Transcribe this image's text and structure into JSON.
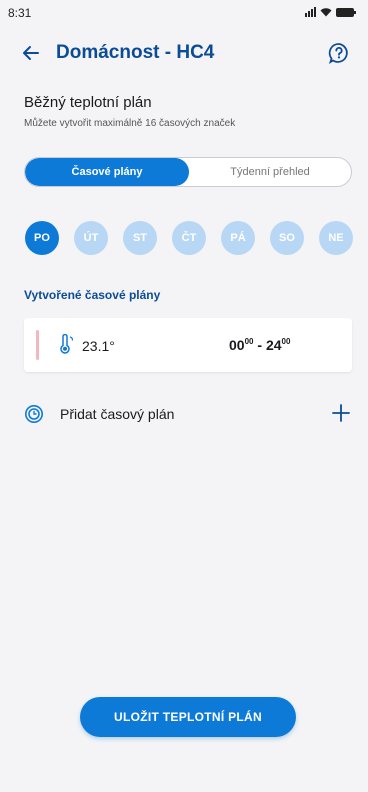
{
  "status_bar": {
    "time": "8:31"
  },
  "app_bar": {
    "title": "Domácnost - HC4"
  },
  "plan": {
    "title": "Běžný teplotní plán",
    "subtitle": "Můžete vytvořit maximálně 16 časových značek"
  },
  "tabs": [
    {
      "label": "Časové plány",
      "active": true
    },
    {
      "label": "Týdenní přehled",
      "active": false
    }
  ],
  "days": [
    {
      "label": "PO",
      "active": true
    },
    {
      "label": "ÚT",
      "active": false
    },
    {
      "label": "ST",
      "active": false
    },
    {
      "label": "ČT",
      "active": false
    },
    {
      "label": "PÁ",
      "active": false
    },
    {
      "label": "SO",
      "active": false
    },
    {
      "label": "NE",
      "active": false
    }
  ],
  "section_title": "Vytvořené časové plány",
  "schedules": [
    {
      "temperature": "23.1°",
      "start_h": "00",
      "start_m": "00",
      "separator": " - ",
      "end_h": "24",
      "end_m": "00"
    }
  ],
  "add_plan_label": "Přidat časový plán",
  "save_button": "ULOŽIT TEPLOTNÍ PLÁN",
  "colors": {
    "primary": "#0e7ad8",
    "title": "#0c4c97",
    "day_inactive": "#b7d7f5",
    "accent": "#f3b8be"
  }
}
